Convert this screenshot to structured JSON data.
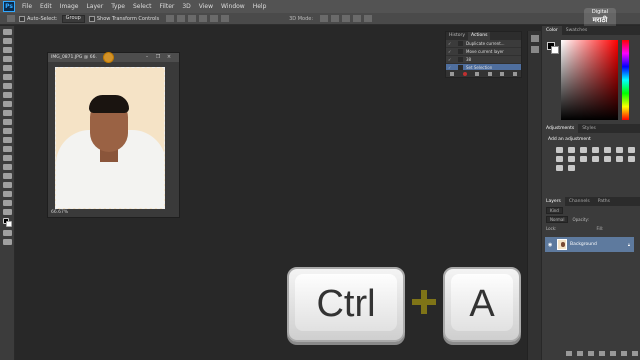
{
  "app": {
    "logo": "Ps"
  },
  "menu": [
    "File",
    "Edit",
    "Image",
    "Layer",
    "Type",
    "Select",
    "Filter",
    "3D",
    "View",
    "Window",
    "Help"
  ],
  "options": {
    "auto_select": "Auto-Select:",
    "auto_select_mode": "Group",
    "show_transform": "Show Transform Controls",
    "mode_3d": "3D Mode:"
  },
  "watermark": {
    "line1": "Digital",
    "line2": "मराठी"
  },
  "document": {
    "title": "IMG_0871.JPG @ 66.",
    "zoom": "66.67%",
    "ctl_min": "–",
    "ctl_max": "❐",
    "ctl_close": "×"
  },
  "actions_panel": {
    "tabs": [
      "History",
      "Actions"
    ],
    "rows": [
      "Duplicate current...",
      "Move current layer",
      "38",
      "Set Selection"
    ]
  },
  "right_panel": {
    "color_tabs": [
      "Color",
      "Swatches"
    ],
    "adjust_tabs": [
      "Adjustments",
      "Styles"
    ],
    "adjust_title": "Add an adjustment",
    "layers_tabs": [
      "Layers",
      "Channels",
      "Paths"
    ],
    "kind": "Kind",
    "blend": "Normal",
    "opacity": "Opacity:",
    "lock": "Lock:",
    "fill": "Fill:",
    "layer_name": "Background"
  },
  "keys": {
    "ctrl": "Ctrl",
    "a": "A"
  }
}
